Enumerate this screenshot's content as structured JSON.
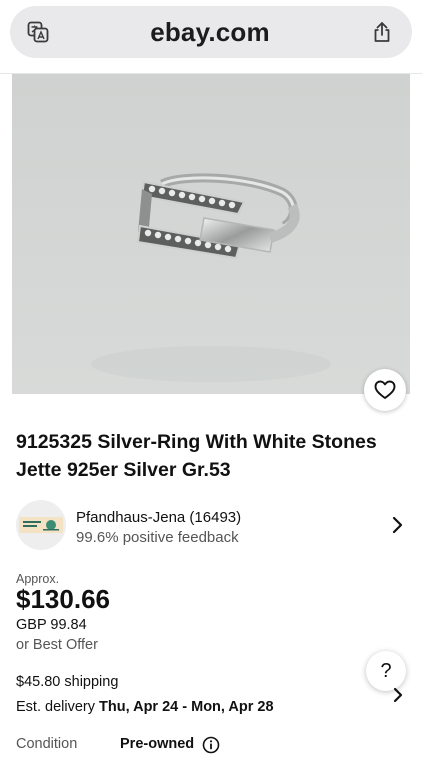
{
  "browser": {
    "url": "ebay.com",
    "icons": {
      "translate": "translate-icon",
      "share": "share-icon"
    }
  },
  "listing": {
    "title": "9125325 Silver-Ring With White Stones Jette 925er Silver Gr.53",
    "image_alt": "silver ring with white stones",
    "watch_icon": "heart-icon"
  },
  "seller": {
    "name": "Pfandhaus-Jena (16493)",
    "feedback": "99.6% positive feedback"
  },
  "price": {
    "approx_label": "Approx.",
    "usd": "$130.66",
    "gbp": "GBP 99.84",
    "best_offer": "or Best Offer"
  },
  "shipping": {
    "cost": "$45.80 shipping",
    "delivery_label": "Est. delivery",
    "delivery_dates": "Thu, Apr 24 - Mon, Apr 28"
  },
  "condition": {
    "label": "Condition",
    "value": "Pre-owned"
  },
  "help": {
    "label": "?"
  },
  "colors": {
    "url_bar_bg": "#e9e9eb",
    "image_bg": "#d3d6d4",
    "text": "#111111",
    "muted": "#555555"
  }
}
